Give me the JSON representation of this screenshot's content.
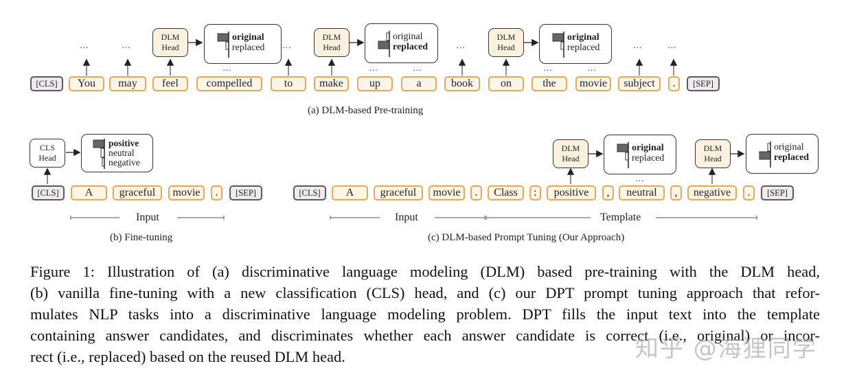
{
  "panel_a": {
    "caption": "(a) DLM-based Pre-training",
    "tokens": [
      "[CLS]",
      "You",
      "may",
      "feel",
      "compelled",
      "to",
      "make",
      "up",
      "a",
      "book",
      "on",
      "the",
      "movie",
      "subject",
      ".",
      "[SEP]"
    ],
    "heads": [
      {
        "label_line1": "DLM",
        "label_line2": "Head",
        "output": {
          "top": "original",
          "bottom": "replaced",
          "selected": "original"
        }
      },
      {
        "label_line1": "DLM",
        "label_line2": "Head",
        "output": {
          "top": "original",
          "bottom": "replaced",
          "selected": "replaced"
        }
      },
      {
        "label_line1": "DLM",
        "label_line2": "Head",
        "output": {
          "top": "original",
          "bottom": "replaced",
          "selected": "original"
        }
      }
    ],
    "ellipsis": "…"
  },
  "panel_b": {
    "caption": "(b) Fine-tuning",
    "tokens": [
      "[CLS]",
      "A",
      "graceful",
      "movie",
      ".",
      "[SEP]"
    ],
    "head": {
      "label_line1": "CLS",
      "label_line2": "Head",
      "output": [
        "positive",
        "neutral",
        "negative"
      ],
      "selected": "positive"
    },
    "bracket_label": "Input"
  },
  "panel_c": {
    "caption": "(c) DLM-based Prompt Tuning (Our Approach)",
    "tokens": [
      "[CLS]",
      "A",
      "graceful",
      "movie",
      ".",
      "Class",
      ":",
      "positive",
      ",",
      "neutral",
      ",",
      "negative",
      ".",
      "[SEP]"
    ],
    "heads": [
      {
        "label_line1": "DLM",
        "label_line2": "Head",
        "output": {
          "top": "original",
          "bottom": "replaced",
          "selected": "original"
        }
      },
      {
        "label_line1": "DLM",
        "label_line2": "Head",
        "output": {
          "top": "original",
          "bottom": "replaced",
          "selected": "replaced"
        }
      }
    ],
    "bracket_labels": {
      "input": "Input",
      "template": "Template"
    },
    "ellipsis": "…"
  },
  "figure_caption": {
    "lines": [
      "Figure 1: Illustration of (a) discriminative language modeling (DLM) based pre-training with the DLM head,",
      "(b) vanilla fine-tuning with a new classification (CLS) head, and (c) our DPT prompt tuning approach that refor-",
      "mulates NLP tasks into a discriminative language modeling problem. DPT fills the input text into the template",
      "containing answer candidates, and discriminates whether each answer candidate is correct (i.e., original) or incor-",
      "rect (i.e., replaced) based on the reused DLM head."
    ]
  },
  "watermark": "知乎 @海狸同学"
}
